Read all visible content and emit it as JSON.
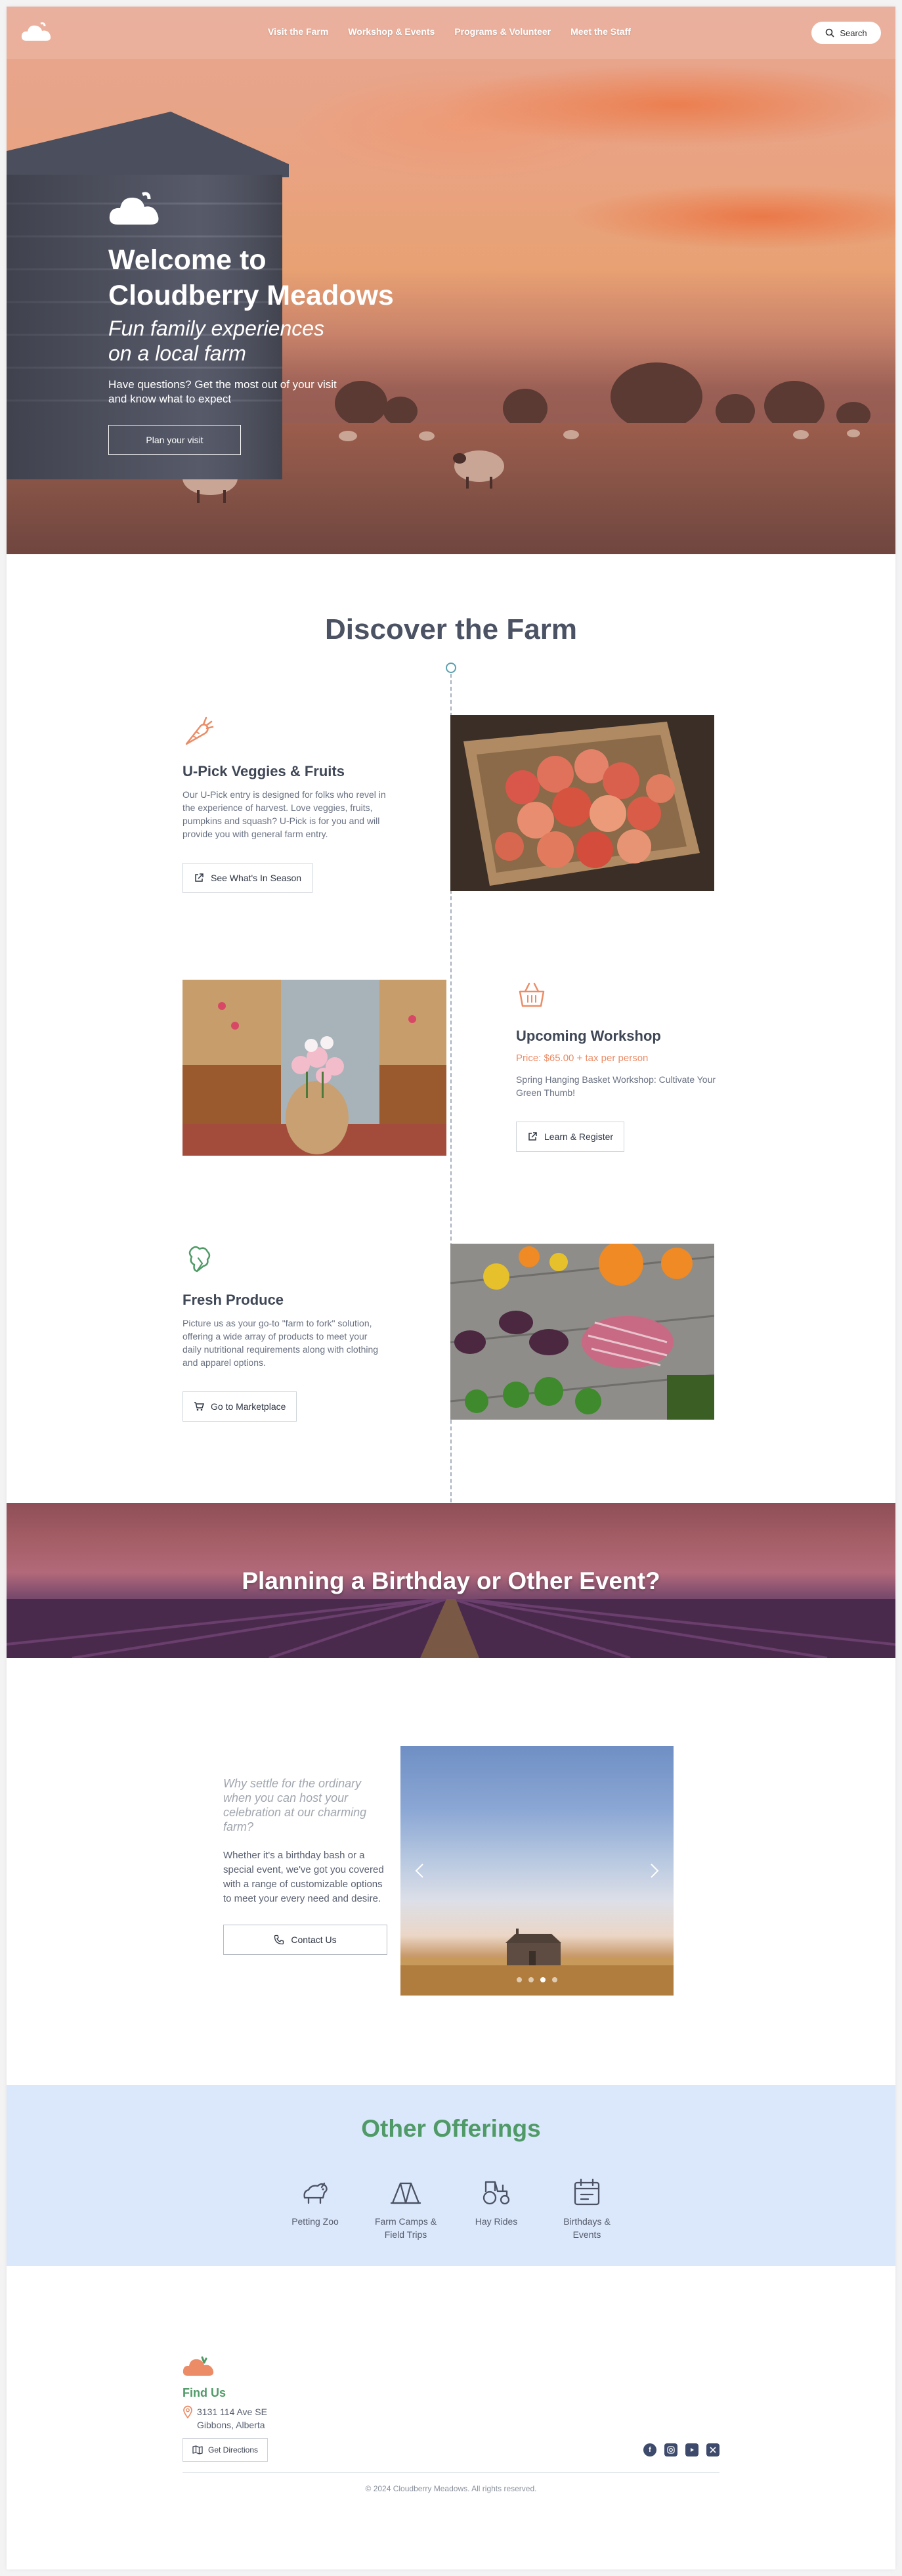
{
  "nav": {
    "links": [
      "Visit the Farm",
      "Workshop & Events",
      "Programs & Volunteer",
      "Meet the Staff"
    ],
    "search_label": "Search"
  },
  "hero": {
    "title_line1": "Welcome to",
    "title_line2": "Cloudberry Meadows",
    "subtitle_line1": "Fun family experiences",
    "subtitle_line2": "on a local farm",
    "description": "Have questions? Get the most out of your visit and know what to expect",
    "cta_label": "Plan your visit"
  },
  "discover": {
    "title": "Discover the Farm",
    "features": [
      {
        "icon": "carrot-icon",
        "title": "U-Pick Veggies & Fruits",
        "description": "Our U-Pick entry is designed for folks who revel in the experience of harvest. Love veggies, fruits, pumpkins and squash? U-Pick is for you and will provide you with general farm entry.",
        "button": "See What's In Season"
      },
      {
        "icon": "basket-icon",
        "title": "Upcoming Workshop",
        "price": "Price: $65.00 + tax per person",
        "description": "Spring Hanging Basket Workshop: Cultivate Your Green Thumb!",
        "button": "Learn & Register"
      },
      {
        "icon": "broccoli-icon",
        "title": "Fresh Produce",
        "description": "Picture us as your go-to \"farm to fork\" solution, offering a wide array of products to meet your daily nutritional requirements along with clothing and apparel options.",
        "button": "Go to Marketplace"
      }
    ]
  },
  "event_banner": {
    "title": "Planning a Birthday or Other Event?"
  },
  "party": {
    "lead": "Why settle for the ordinary when you can host your celebration at our charming farm?",
    "description": "Whether it's a birthday bash or a special event, we've got you covered with a range of customizable options to meet your every need and desire.",
    "button": "Contact Us",
    "carousel": {
      "slide_count": 4,
      "active_slide": 3
    }
  },
  "offerings": {
    "title": "Other Offerings",
    "items": [
      {
        "icon": "petting-zoo-icon",
        "label": "Petting Zoo"
      },
      {
        "icon": "tent-icon",
        "label": "Farm Camps & Field Trips"
      },
      {
        "icon": "tractor-icon",
        "label": "Hay Rides"
      },
      {
        "icon": "calendar-icon",
        "label": "Birthdays & Events"
      }
    ]
  },
  "footer": {
    "find_us": "Find Us",
    "address_line1": "3131 114 Ave SE",
    "address_line2": "Gibbons, Alberta",
    "directions_button": "Get Directions",
    "socials": [
      "facebook-icon",
      "instagram-icon",
      "youtube-icon",
      "x-icon"
    ],
    "copyright": "© 2024 Cloudberry Meadows. All rights reserved."
  },
  "colors": {
    "accent_orange": "#ec8c66",
    "accent_green": "#4f9a67",
    "heading_gray": "#4a5263",
    "offerings_bg": "#dbe7fb"
  }
}
